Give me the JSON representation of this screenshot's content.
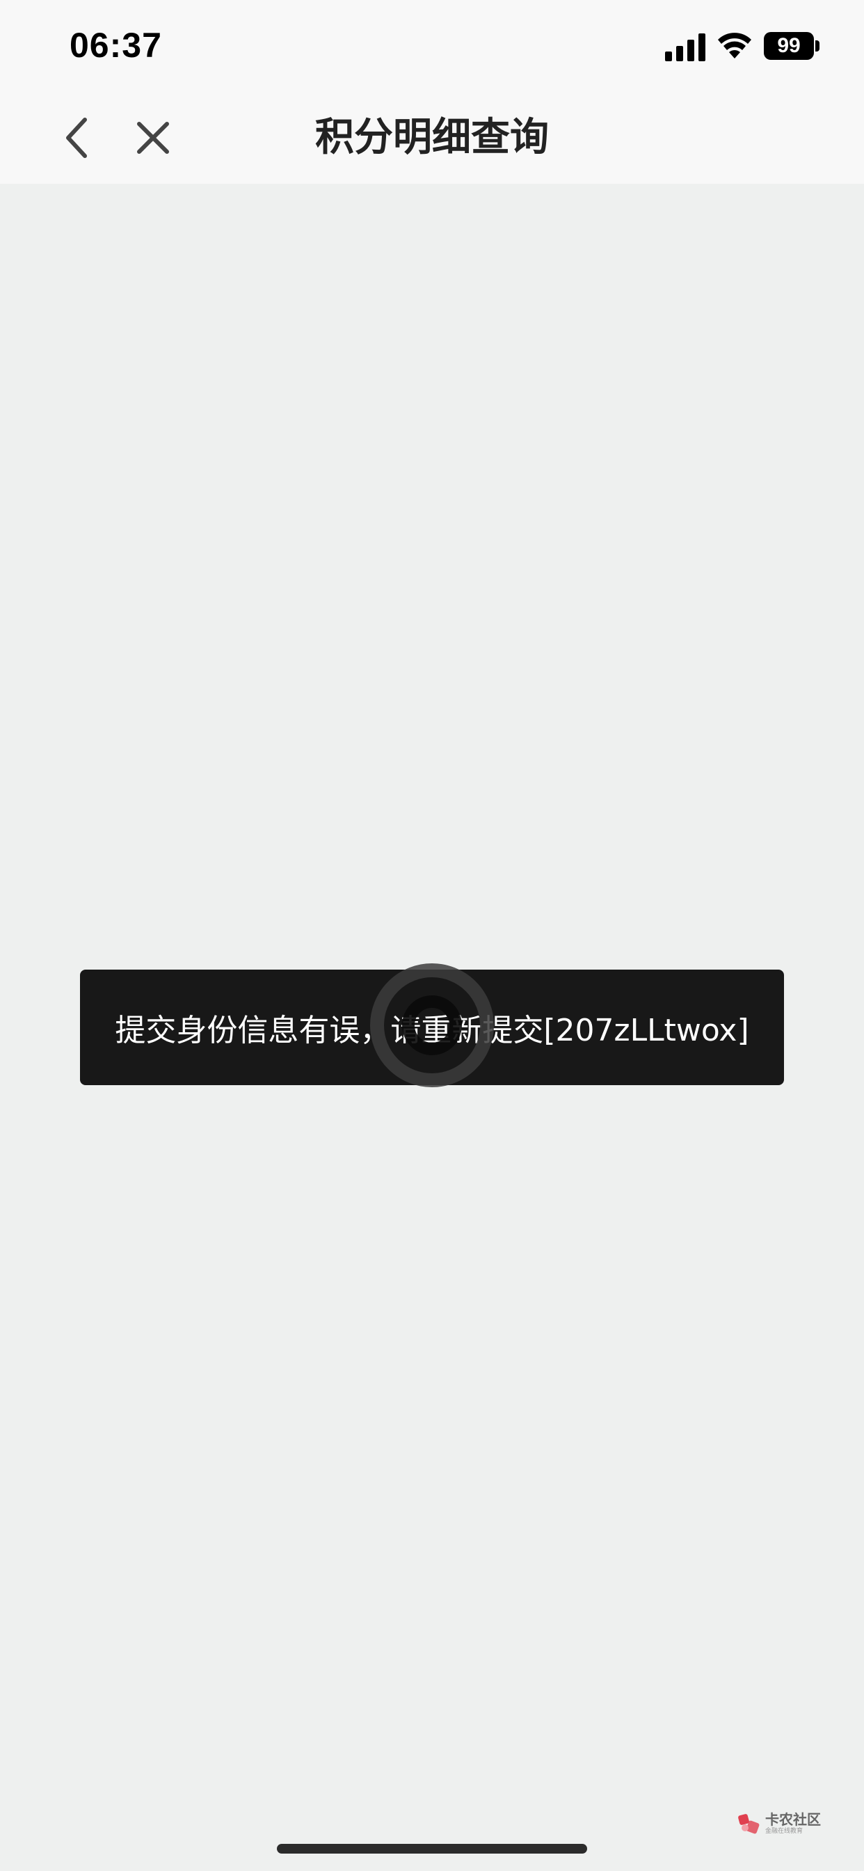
{
  "status_bar": {
    "time": "06:37",
    "battery_level": "99",
    "signal_icon": "cellular-signal-icon",
    "wifi_icon": "wifi-icon"
  },
  "nav_bar": {
    "title": "积分明细查询",
    "back_icon": "chevron-left-icon",
    "close_icon": "close-icon"
  },
  "toast": {
    "message": "提交身份信息有误，请重新提交[207zLLtwox]"
  },
  "watermark": {
    "name": "卡农社区",
    "subtitle": "金融在线教育"
  },
  "colors": {
    "background": "#eef0ef",
    "nav_background": "#f8f8f8",
    "toast_background": "#181818",
    "title_color": "#222222",
    "watermark_logo": "#e0404f"
  }
}
